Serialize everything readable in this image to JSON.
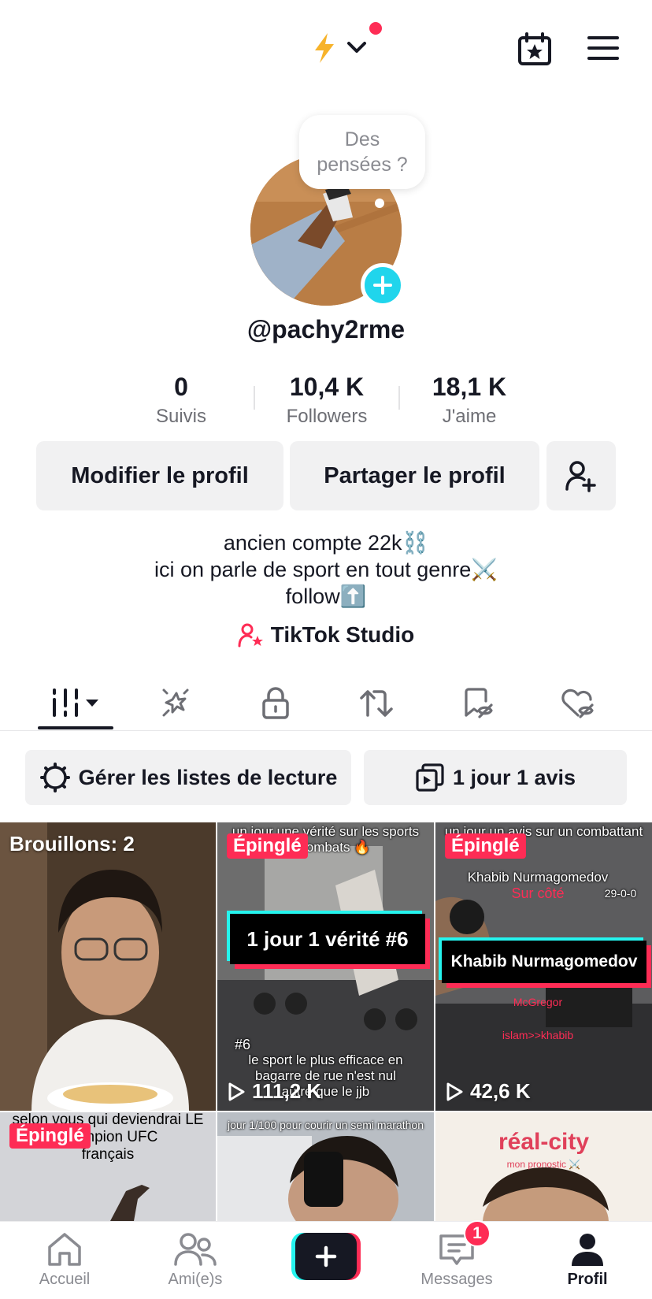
{
  "top_bar": {
    "icons": [
      "lightning-icon",
      "chevron-down-icon",
      "notification-dot",
      "calendar-star-icon",
      "menu-icon"
    ],
    "colors": {
      "lightning": "#f7b32b",
      "dot": "#fe2c55"
    }
  },
  "profile": {
    "thought_bubble": "Des pensées ?",
    "handle": "@pachy2rme",
    "stats": [
      {
        "value": "0",
        "label": "Suivis"
      },
      {
        "value": "10,4 K",
        "label": "Followers"
      },
      {
        "value": "18,1 K",
        "label": "J'aime"
      }
    ],
    "edit_label": "Modifier le profil",
    "share_label": "Partager le profil",
    "bio": [
      "ancien compte 22k⛓️",
      "ici on parle de sport en tout genre⚔️",
      "follow⬆️"
    ],
    "studio_label": "TikTok Studio"
  },
  "tabs": [
    "videos-grid",
    "sparkle",
    "lock",
    "repost",
    "favorites-hidden",
    "liked-hidden"
  ],
  "pills": {
    "playlists": "Gérer les listes de lecture",
    "series": "1 jour 1 avis"
  },
  "grid": [
    {
      "caption": "Brouillons: 2"
    },
    {
      "pinned": "Épinglé",
      "top_text": "un jour une vérité sur les sports de combats 🔥",
      "banner": "1 jour 1 vérité #6",
      "bottom_text": [
        "#6",
        "le sport le plus efficace en",
        "bagarre de rue n'est nul",
        "autre que le jjb"
      ],
      "views": "111,2 K"
    },
    {
      "pinned": "Épinglé",
      "top_text": "un jour un avis sur un combattant",
      "name_text": "Khabib Nurmagomedov",
      "sub_text": "Sur côté",
      "record": "29-0-0",
      "banner": "Khabib Nurmagomedov",
      "extra1": "McGregor",
      "extra2": "islam>>khabib",
      "views": "42,6 K"
    },
    {
      "pinned": "Épinglé",
      "top_text": [
        "selon vous qui deviendrai LE",
        "champion UFC",
        "français"
      ]
    },
    {
      "top_text": "jour 1/100 pour courir un semi marathon"
    },
    {
      "title": "réal-city",
      "subtitle": "mon pronostic ⚔️"
    }
  ],
  "nav": {
    "home": "Accueil",
    "friends": "Ami(e)s",
    "messages": "Messages",
    "messages_badge": "1",
    "profile": "Profil"
  }
}
